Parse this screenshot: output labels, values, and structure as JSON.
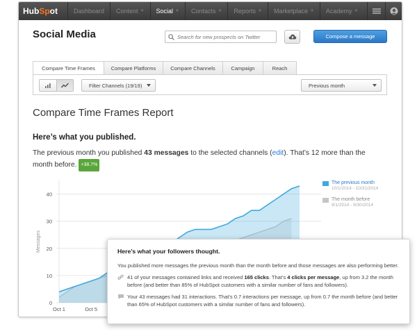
{
  "navbar": {
    "logo_hub": "Hub",
    "logo_spot": "Sp",
    "logo_ot": "ot",
    "items": [
      {
        "label": "Dashboard",
        "caret": false,
        "active": false
      },
      {
        "label": "Content",
        "caret": true,
        "active": false
      },
      {
        "label": "Social",
        "caret": true,
        "active": true
      },
      {
        "label": "Contacts",
        "caret": true,
        "active": false
      },
      {
        "label": "Reports",
        "caret": true,
        "active": false
      },
      {
        "label": "Marketplace",
        "caret": true,
        "active": false
      },
      {
        "label": "Academy",
        "caret": true,
        "active": false
      }
    ]
  },
  "header": {
    "title": "Social Media",
    "search_placeholder": "Search for new prospects on Twitter",
    "compose_label": "Compose a message"
  },
  "tabs": [
    {
      "label": "Compare Time Frames",
      "active": true
    },
    {
      "label": "Compare Platforms",
      "active": false
    },
    {
      "label": "Compare Channels",
      "active": false
    },
    {
      "label": "Campaign",
      "active": false
    },
    {
      "label": "Reach",
      "active": false
    }
  ],
  "toolbar": {
    "filter_label": "Filter Channels",
    "filter_count": "(19/19)",
    "period_label": "Previous month"
  },
  "report": {
    "title": "Compare Time Frames Report",
    "published_heading": "Here’s what you published.",
    "p_1": "The previous month you published ",
    "p_messages": "43 messages",
    "p_2": " to the selected channels (",
    "p_edit": "edit",
    "p_3": "). That’s 12 more than the month before. ",
    "p_badge": "+38.7%"
  },
  "legend": [
    {
      "name": "The previous month",
      "range": "10/1/2014 - 10/31/2014",
      "color": "#3fa9de"
    },
    {
      "name": "The month before",
      "range": "9/1/2014 - 9/30/2014",
      "color": "#c6c6c6"
    }
  ],
  "popup": {
    "heading": "Here’s what your followers thought.",
    "intro": "You published more messages the previous month than the month before and those messages are also performing better.",
    "item1_a": "41 of your messages contained links and received ",
    "item1_b": "165 clicks",
    "item1_c": ". That’s ",
    "item1_d": "4 clicks per message",
    "item1_e": ", up from 3.2 the month before (and better than 85% of HubSpot customers with a similar number of fans and followers).",
    "item2": "Your 43 messages had 31 interactions. That’s 0.7 interactions per message, up from 0.7 the month before (and better than 65% of HubSpot customers with a similar number of fans and followers)."
  },
  "chart_data": {
    "type": "area",
    "ylabel": "Messages",
    "ylim": [
      0,
      45
    ],
    "yticks": [
      0,
      10,
      20,
      30,
      40
    ],
    "x_tick_labels": [
      "Oct 1",
      "Oct 5"
    ],
    "x_tick_days": [
      1,
      5
    ],
    "grid": true,
    "legend_placement": "right",
    "series": [
      {
        "name": "The previous month",
        "color": "#3fa9de",
        "x": [
          1,
          2,
          3,
          4,
          5,
          6,
          7,
          8,
          9,
          10,
          11,
          12,
          13,
          14,
          15,
          16,
          17,
          18,
          19,
          20,
          21,
          22,
          23,
          24,
          25,
          26,
          27,
          28,
          29,
          30,
          31
        ],
        "values": [
          4,
          5,
          6,
          7,
          8,
          9,
          11,
          12,
          13,
          14,
          15,
          16,
          18,
          20,
          22,
          24,
          26,
          27,
          27,
          27,
          28,
          29,
          31,
          32,
          34,
          34,
          36,
          38,
          40,
          42,
          43
        ]
      },
      {
        "name": "The month before",
        "color": "#c6c6c6",
        "x": [
          1,
          2,
          3,
          4,
          5,
          6,
          7,
          8,
          9,
          10,
          11,
          12,
          13,
          14,
          15,
          16,
          17,
          18,
          19,
          20,
          21,
          22,
          23,
          24,
          25,
          26,
          27,
          28,
          29,
          30
        ],
        "values": [
          2,
          4,
          6,
          7,
          8,
          9,
          10,
          11,
          12,
          13,
          14,
          15,
          15,
          16,
          16,
          17,
          17,
          18,
          19,
          20,
          21,
          22,
          23,
          24,
          25,
          26,
          27,
          28,
          30,
          31
        ]
      }
    ]
  }
}
